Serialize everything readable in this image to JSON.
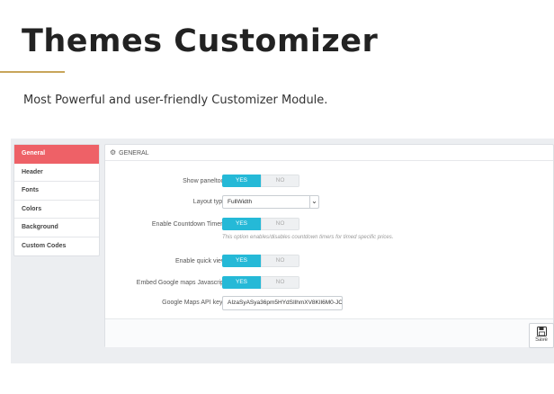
{
  "hero": {
    "title": "Themes Customizer",
    "subtitle": "Most Powerful and user-friendly Customizer Module."
  },
  "sidebar": {
    "items": [
      {
        "label": "General",
        "active": true
      },
      {
        "label": "Header",
        "active": false
      },
      {
        "label": "Fonts",
        "active": false
      },
      {
        "label": "Colors",
        "active": false
      },
      {
        "label": "Background",
        "active": false
      },
      {
        "label": "Custom Codes",
        "active": false
      }
    ]
  },
  "panel": {
    "header_title": "GENERAL",
    "header_icon": "gear-icon",
    "fields": {
      "show_paneltool": {
        "label": "Show paneltool",
        "yes": "YES",
        "no": "NO",
        "value": "YES"
      },
      "layout_type": {
        "label": "Layout type",
        "value": "FullWidth"
      },
      "countdown": {
        "label": "Enable Countdown Timers",
        "yes": "YES",
        "no": "NO",
        "value": "YES",
        "help": "This option enables/disables countdown timers for timed specific prices."
      },
      "quick_view": {
        "label": "Enable quick view",
        "yes": "YES",
        "no": "NO",
        "value": "YES"
      },
      "google_maps_js": {
        "label": "Embed Google maps Javascript",
        "yes": "YES",
        "no": "NO",
        "value": "YES"
      },
      "google_maps_key": {
        "label": "Google Maps API keys",
        "value": "AIzaSyASya36pm5HYdSIlhmXV8KIl6M0-JC"
      }
    },
    "save_label": "Save"
  },
  "colors": {
    "active_tab": "#ee6167",
    "toggle_on": "#25b9d7",
    "accent_rule": "#c8a55a"
  }
}
